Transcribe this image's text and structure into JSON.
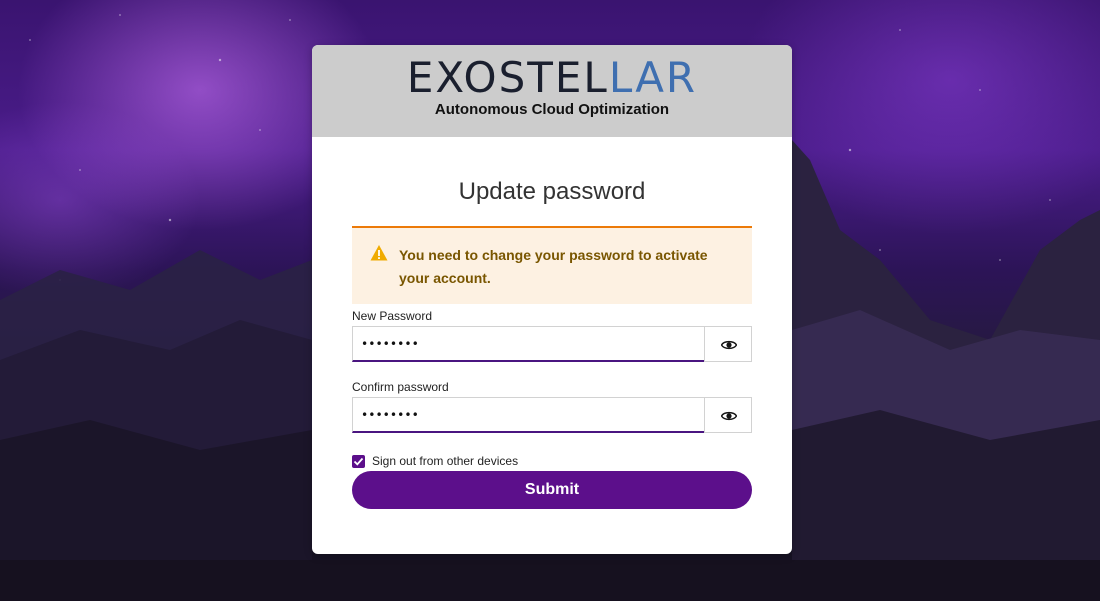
{
  "header": {
    "logo_part1": "EXOSTEL",
    "logo_part2": "LAR",
    "tagline": "Autonomous Cloud Optimization"
  },
  "form": {
    "title": "Update password",
    "alert_text": "You need to change your password to activate your account.",
    "new_password_label": "New Password",
    "new_password_value": "••••••••",
    "confirm_password_label": "Confirm password",
    "confirm_password_value": "••••••••",
    "sign_out_label": "Sign out from other devices",
    "sign_out_checked": true,
    "submit_label": "Submit"
  },
  "colors": {
    "primary": "#5c0f8b",
    "alert_bg": "#fdf1e2",
    "alert_border": "#ec7a08",
    "alert_text": "#795600",
    "header_bg": "#cccccc"
  },
  "icons": {
    "alert": "warning-triangle-icon",
    "toggle_password": "eye-icon",
    "checkbox": "check-icon"
  }
}
